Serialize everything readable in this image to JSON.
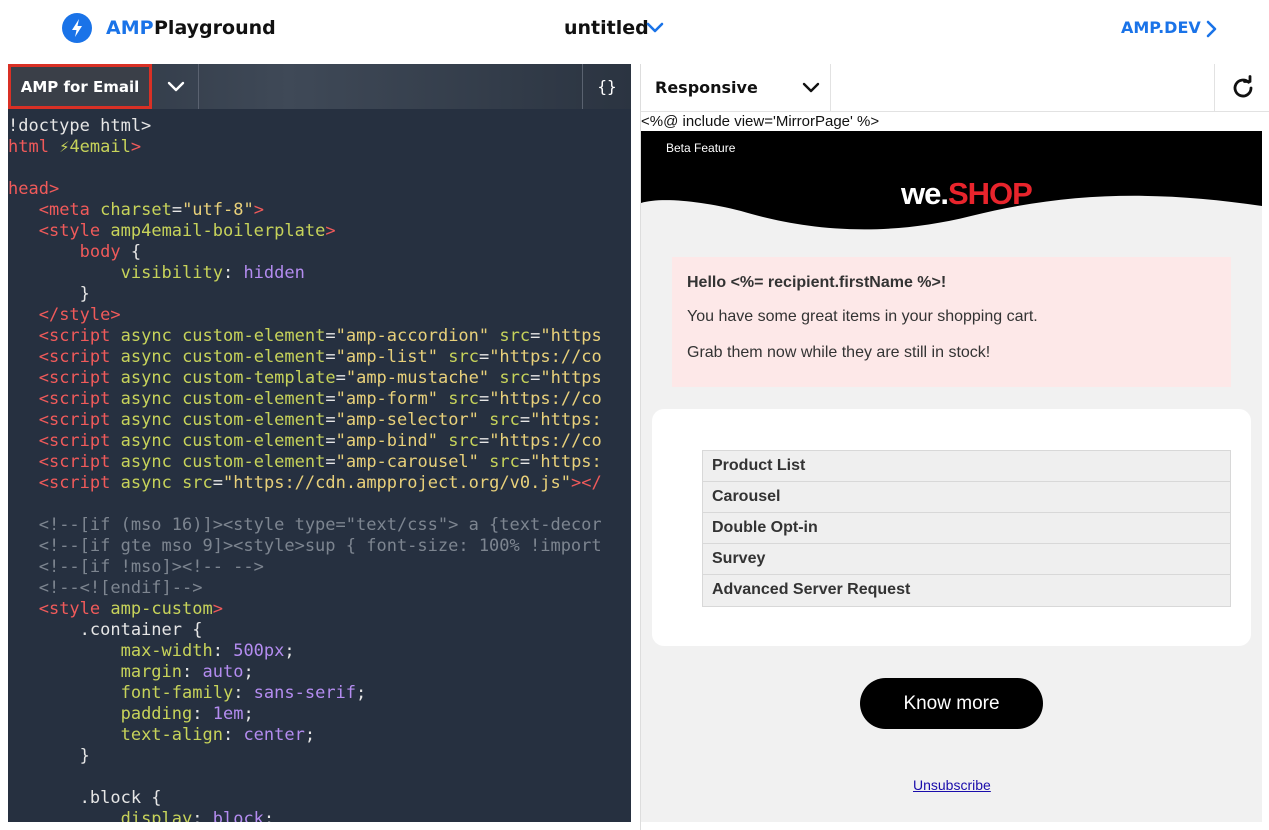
{
  "header": {
    "brand_amp": "AMP",
    "brand_playground": "Playground",
    "doc_title": "untitled",
    "link": "AMP.DEV",
    "accent": "#1a73e8"
  },
  "editor": {
    "format_label": "AMP for Email",
    "braces_label": "{}",
    "highlight_color": "#d93025",
    "lines": [
      [
        [
          "t-txt",
          "!doctype html>"
        ]
      ],
      [
        [
          "t-tag",
          "html"
        ],
        [
          "t-txt",
          " "
        ],
        [
          "t-attr",
          "⚡4email"
        ],
        [
          "t-tag",
          ">"
        ]
      ],
      [
        [
          "t-txt",
          ""
        ]
      ],
      [
        [
          "t-tag",
          "head>"
        ]
      ],
      [
        [
          "t-txt",
          "   "
        ],
        [
          "t-tag",
          "<meta"
        ],
        [
          "t-txt",
          " "
        ],
        [
          "t-attr",
          "charset"
        ],
        [
          "t-txt",
          "="
        ],
        [
          "t-str",
          "\"utf-8\""
        ],
        [
          "t-tag",
          ">"
        ]
      ],
      [
        [
          "t-txt",
          "   "
        ],
        [
          "t-tag",
          "<style"
        ],
        [
          "t-txt",
          " "
        ],
        [
          "t-attr",
          "amp4email-boilerplate"
        ],
        [
          "t-tag",
          ">"
        ]
      ],
      [
        [
          "t-txt",
          "       "
        ],
        [
          "t-tag",
          "body"
        ],
        [
          "t-txt",
          " {"
        ]
      ],
      [
        [
          "t-txt",
          "           "
        ],
        [
          "t-prop",
          "visibility"
        ],
        [
          "t-txt",
          ": "
        ],
        [
          "t-val",
          "hidden"
        ]
      ],
      [
        [
          "t-txt",
          "       }"
        ]
      ],
      [
        [
          "t-txt",
          "   "
        ],
        [
          "t-tag",
          "</style>"
        ]
      ],
      [
        [
          "t-txt",
          "   "
        ],
        [
          "t-tag",
          "<script"
        ],
        [
          "t-txt",
          " "
        ],
        [
          "t-attr",
          "async"
        ],
        [
          "t-txt",
          " "
        ],
        [
          "t-attr",
          "custom-element"
        ],
        [
          "t-txt",
          "="
        ],
        [
          "t-str",
          "\"amp-accordion\""
        ],
        [
          "t-txt",
          " "
        ],
        [
          "t-attr",
          "src"
        ],
        [
          "t-txt",
          "="
        ],
        [
          "t-str",
          "\"https"
        ]
      ],
      [
        [
          "t-txt",
          "   "
        ],
        [
          "t-tag",
          "<script"
        ],
        [
          "t-txt",
          " "
        ],
        [
          "t-attr",
          "async"
        ],
        [
          "t-txt",
          " "
        ],
        [
          "t-attr",
          "custom-element"
        ],
        [
          "t-txt",
          "="
        ],
        [
          "t-str",
          "\"amp-list\""
        ],
        [
          "t-txt",
          " "
        ],
        [
          "t-attr",
          "src"
        ],
        [
          "t-txt",
          "="
        ],
        [
          "t-str",
          "\"https://co"
        ]
      ],
      [
        [
          "t-txt",
          "   "
        ],
        [
          "t-tag",
          "<script"
        ],
        [
          "t-txt",
          " "
        ],
        [
          "t-attr",
          "async"
        ],
        [
          "t-txt",
          " "
        ],
        [
          "t-attr",
          "custom-template"
        ],
        [
          "t-txt",
          "="
        ],
        [
          "t-str",
          "\"amp-mustache\""
        ],
        [
          "t-txt",
          " "
        ],
        [
          "t-attr",
          "src"
        ],
        [
          "t-txt",
          "="
        ],
        [
          "t-str",
          "\"https"
        ]
      ],
      [
        [
          "t-txt",
          "   "
        ],
        [
          "t-tag",
          "<script"
        ],
        [
          "t-txt",
          " "
        ],
        [
          "t-attr",
          "async"
        ],
        [
          "t-txt",
          " "
        ],
        [
          "t-attr",
          "custom-element"
        ],
        [
          "t-txt",
          "="
        ],
        [
          "t-str",
          "\"amp-form\""
        ],
        [
          "t-txt",
          " "
        ],
        [
          "t-attr",
          "src"
        ],
        [
          "t-txt",
          "="
        ],
        [
          "t-str",
          "\"https://co"
        ]
      ],
      [
        [
          "t-txt",
          "   "
        ],
        [
          "t-tag",
          "<script"
        ],
        [
          "t-txt",
          " "
        ],
        [
          "t-attr",
          "async"
        ],
        [
          "t-txt",
          " "
        ],
        [
          "t-attr",
          "custom-element"
        ],
        [
          "t-txt",
          "="
        ],
        [
          "t-str",
          "\"amp-selector\""
        ],
        [
          "t-txt",
          " "
        ],
        [
          "t-attr",
          "src"
        ],
        [
          "t-txt",
          "="
        ],
        [
          "t-str",
          "\"https:"
        ]
      ],
      [
        [
          "t-txt",
          "   "
        ],
        [
          "t-tag",
          "<script"
        ],
        [
          "t-txt",
          " "
        ],
        [
          "t-attr",
          "async"
        ],
        [
          "t-txt",
          " "
        ],
        [
          "t-attr",
          "custom-element"
        ],
        [
          "t-txt",
          "="
        ],
        [
          "t-str",
          "\"amp-bind\""
        ],
        [
          "t-txt",
          " "
        ],
        [
          "t-attr",
          "src"
        ],
        [
          "t-txt",
          "="
        ],
        [
          "t-str",
          "\"https://co"
        ]
      ],
      [
        [
          "t-txt",
          "   "
        ],
        [
          "t-tag",
          "<script"
        ],
        [
          "t-txt",
          " "
        ],
        [
          "t-attr",
          "async"
        ],
        [
          "t-txt",
          " "
        ],
        [
          "t-attr",
          "custom-element"
        ],
        [
          "t-txt",
          "="
        ],
        [
          "t-str",
          "\"amp-carousel\""
        ],
        [
          "t-txt",
          " "
        ],
        [
          "t-attr",
          "src"
        ],
        [
          "t-txt",
          "="
        ],
        [
          "t-str",
          "\"https:"
        ]
      ],
      [
        [
          "t-txt",
          "   "
        ],
        [
          "t-tag",
          "<script"
        ],
        [
          "t-txt",
          " "
        ],
        [
          "t-attr",
          "async"
        ],
        [
          "t-txt",
          " "
        ],
        [
          "t-attr",
          "src"
        ],
        [
          "t-txt",
          "="
        ],
        [
          "t-str",
          "\"https://cdn.ampproject.org/v0.js\""
        ],
        [
          "t-tag",
          "></"
        ]
      ],
      [
        [
          "t-txt",
          ""
        ]
      ],
      [
        [
          "t-txt",
          "   "
        ],
        [
          "t-com",
          "<!--[if (mso 16)]><style type=\"text/css\"> a {text-decor"
        ]
      ],
      [
        [
          "t-txt",
          "   "
        ],
        [
          "t-com",
          "<!--[if gte mso 9]><style>sup { font-size: 100% !import"
        ]
      ],
      [
        [
          "t-txt",
          "   "
        ],
        [
          "t-com",
          "<!--[if !mso]><!-- -->"
        ]
      ],
      [
        [
          "t-txt",
          "   "
        ],
        [
          "t-com",
          "<!--<![endif]-->"
        ]
      ],
      [
        [
          "t-txt",
          "   "
        ],
        [
          "t-tag",
          "<style"
        ],
        [
          "t-txt",
          " "
        ],
        [
          "t-attr",
          "amp-custom"
        ],
        [
          "t-tag",
          ">"
        ]
      ],
      [
        [
          "t-txt",
          "       .container {"
        ]
      ],
      [
        [
          "t-txt",
          "           "
        ],
        [
          "t-prop",
          "max-width"
        ],
        [
          "t-txt",
          ": "
        ],
        [
          "t-val",
          "500px"
        ],
        [
          "t-txt",
          ";"
        ]
      ],
      [
        [
          "t-txt",
          "           "
        ],
        [
          "t-prop",
          "margin"
        ],
        [
          "t-txt",
          ": "
        ],
        [
          "t-val",
          "auto"
        ],
        [
          "t-txt",
          ";"
        ]
      ],
      [
        [
          "t-txt",
          "           "
        ],
        [
          "t-prop",
          "font-family"
        ],
        [
          "t-txt",
          ": "
        ],
        [
          "t-val",
          "sans-serif"
        ],
        [
          "t-txt",
          ";"
        ]
      ],
      [
        [
          "t-txt",
          "           "
        ],
        [
          "t-prop",
          "padding"
        ],
        [
          "t-txt",
          ": "
        ],
        [
          "t-val",
          "1em"
        ],
        [
          "t-txt",
          ";"
        ]
      ],
      [
        [
          "t-txt",
          "           "
        ],
        [
          "t-prop",
          "text-align"
        ],
        [
          "t-txt",
          ": "
        ],
        [
          "t-val",
          "center"
        ],
        [
          "t-txt",
          ";"
        ]
      ],
      [
        [
          "t-txt",
          "       }"
        ]
      ],
      [
        [
          "t-txt",
          ""
        ]
      ],
      [
        [
          "t-txt",
          "       .block {"
        ]
      ],
      [
        [
          "t-txt",
          "           "
        ],
        [
          "t-prop",
          "display"
        ],
        [
          "t-txt",
          ": "
        ],
        [
          "t-val",
          "block"
        ],
        [
          "t-txt",
          ";"
        ]
      ]
    ]
  },
  "preview": {
    "viewport_label": "Responsive",
    "mirror_text": "<%@ include view='MirrorPage' %>",
    "beta_label": "Beta Feature",
    "logo_we": "we.",
    "logo_shop": "SHOP",
    "greeting": "Hello <%= recipient.firstName %>!",
    "line1": "You have some great items in your shopping cart.",
    "line2": "Grab them now while they are still in stock!",
    "menu": [
      "Product List",
      "Carousel",
      "Double Opt-in",
      "Survey",
      "Advanced Server Request"
    ],
    "cta": "Know more",
    "unsubscribe": "Unsubscribe"
  }
}
